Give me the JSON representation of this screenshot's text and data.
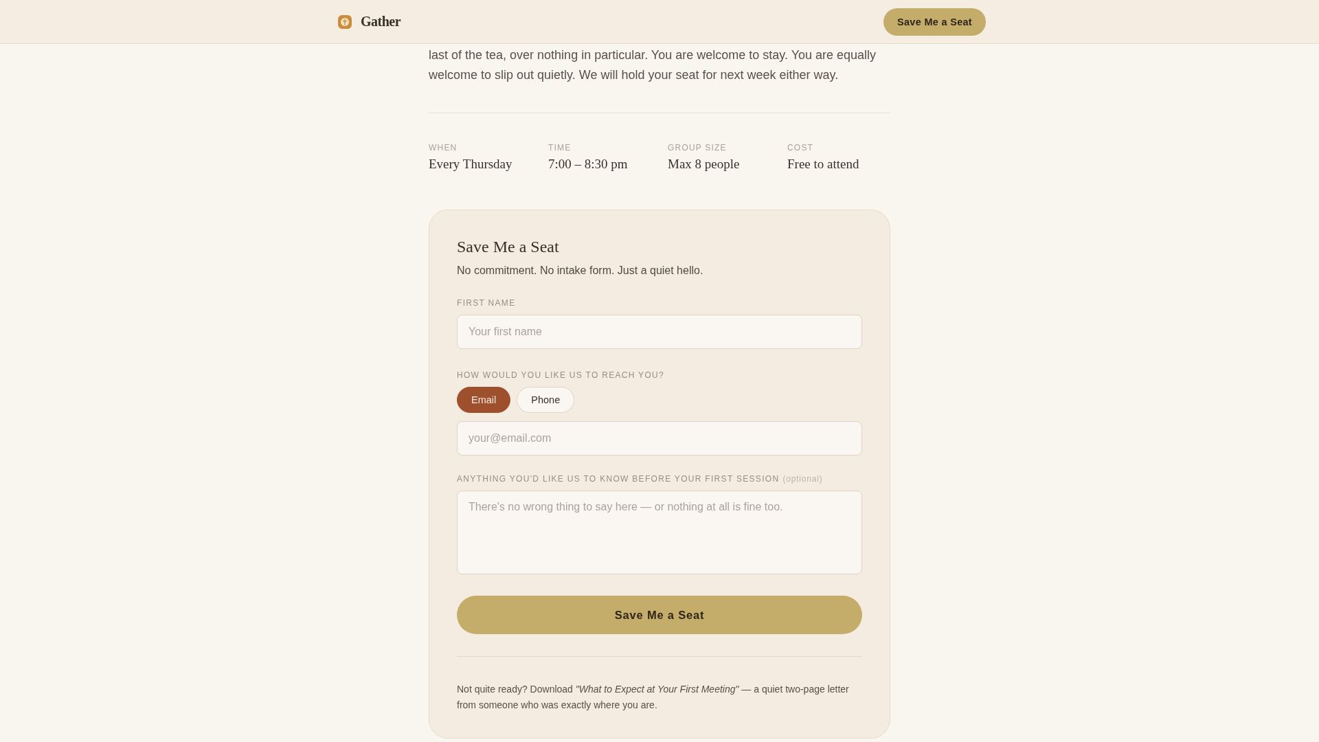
{
  "header": {
    "brand": "Gather",
    "button": "Save Me a Seat"
  },
  "intro": "last of the tea, over nothing in particular. You are welcome to stay. You are equally welcome to slip out quietly. We will hold your seat for next week either way.",
  "details": [
    {
      "label": "WHEN",
      "value": "Every Thursday"
    },
    {
      "label": "TIME",
      "value": "7:00 – 8:30 pm"
    },
    {
      "label": "GROUP SIZE",
      "value": "Max 8 people"
    },
    {
      "label": "COST",
      "value": "Free to attend"
    }
  ],
  "form": {
    "title": "Save Me a Seat",
    "subtitle": "No commitment. No intake form. Just a quiet hello.",
    "first_name": {
      "label": "FIRST NAME",
      "placeholder": "Your first name"
    },
    "contact": {
      "label": "HOW WOULD YOU LIKE US TO REACH YOU?",
      "options": [
        {
          "label": "Email",
          "selected": true
        },
        {
          "label": "Phone",
          "selected": false
        }
      ],
      "placeholder": "your@email.com"
    },
    "notes": {
      "label": "ANYTHING YOU'D LIKE US TO KNOW BEFORE YOUR FIRST SESSION",
      "hint": "(optional)",
      "placeholder": "There's no wrong thing to say here — or nothing at all is fine too."
    },
    "submit": "Save Me a Seat",
    "download_note": "Not quite ready? Download *\"What to Expect at Your First Meeting\"* — a quiet two-page letter from someone who was exactly where you are."
  }
}
